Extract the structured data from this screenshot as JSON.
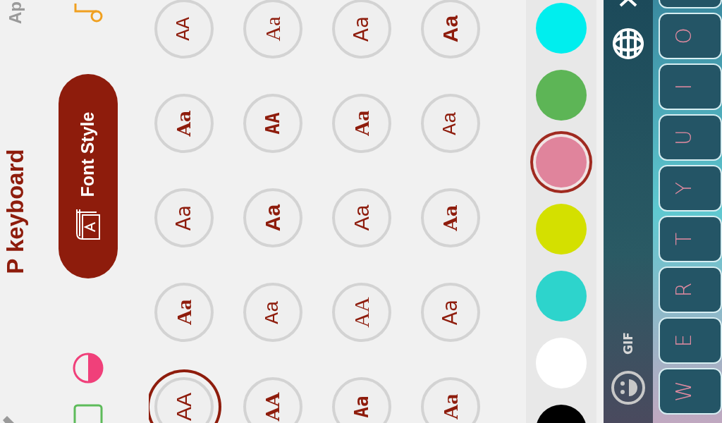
{
  "header": {
    "title": "P keyboard",
    "apps_link": "Ap"
  },
  "tabs": [
    {
      "kind": "sticker",
      "selected": false
    },
    {
      "kind": "color",
      "selected": false
    },
    {
      "kind": "font",
      "label": "Font Style",
      "selected": true
    },
    {
      "kind": "sound",
      "selected": false
    }
  ],
  "font_styles": [
    [
      {
        "sample": "AA",
        "selected": true
      },
      {
        "sample": "Aa",
        "selected": false
      },
      {
        "sample": "Aa",
        "selected": false
      },
      {
        "sample": "Aa",
        "selected": false
      },
      {
        "sample": "AA",
        "selected": false
      }
    ],
    [
      {
        "sample": "AA",
        "selected": false
      },
      {
        "sample": "Aa",
        "selected": false
      },
      {
        "sample": "Aa",
        "selected": false
      },
      {
        "sample": "AA",
        "selected": false
      },
      {
        "sample": "Aa",
        "selected": false
      }
    ],
    [
      {
        "sample": "Aa",
        "selected": false
      },
      {
        "sample": "AA",
        "selected": false
      },
      {
        "sample": "Aa",
        "selected": false
      },
      {
        "sample": "Aa",
        "selected": false
      },
      {
        "sample": "Aa",
        "selected": false
      }
    ],
    [
      {
        "sample": "Aa",
        "selected": false
      },
      {
        "sample": "Aa",
        "selected": false
      },
      {
        "sample": "Aa",
        "selected": false
      },
      {
        "sample": "Aa",
        "selected": false
      },
      {
        "sample": "Aa",
        "selected": false
      }
    ]
  ],
  "colors": [
    {
      "color": "#000000",
      "selected": false
    },
    {
      "color": "#ffffff",
      "selected": false
    },
    {
      "color": "#2dd4cc",
      "selected": false
    },
    {
      "color": "#d4e000",
      "selected": false
    },
    {
      "color": "#e0849c",
      "selected": true
    },
    {
      "color": "#5db556",
      "selected": false
    },
    {
      "color": "#00eeee",
      "selected": false
    }
  ],
  "keyboard": {
    "gif": "GIF",
    "keys": [
      "W",
      "E",
      "R",
      "T",
      "Y",
      "U",
      "I",
      "O"
    ]
  }
}
